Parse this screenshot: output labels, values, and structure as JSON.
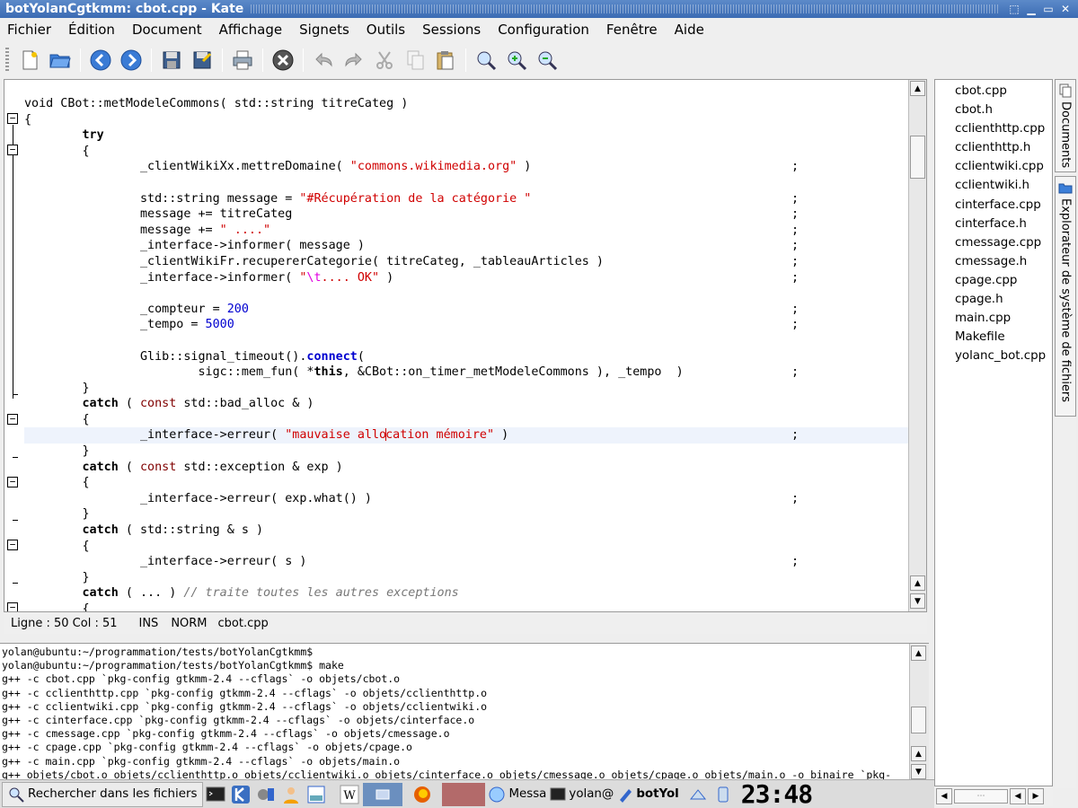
{
  "window": {
    "title": "botYolanCgtkmm: cbot.cpp - Kate",
    "buttons": [
      "⬚",
      "▁",
      "▭",
      "✕"
    ]
  },
  "menu": [
    "Fichier",
    "Édition",
    "Document",
    "Affichage",
    "Signets",
    "Outils",
    "Sessions",
    "Configuration",
    "Fenêtre",
    "Aide"
  ],
  "toolbar_icons": [
    "new-document-icon",
    "open-folder-icon",
    "back-icon",
    "forward-icon",
    "save-icon",
    "save-as-icon",
    "print-icon",
    "close-document-icon",
    "undo-icon",
    "redo-icon",
    "cut-icon",
    "copy-icon",
    "paste-icon",
    "find-icon",
    "zoom-in-icon",
    "zoom-out-icon"
  ],
  "code": [
    {
      "t": "void CBot::metModeleCommons( std::string titreCateg )"
    },
    {
      "t": "{"
    },
    {
      "t": "        try"
    },
    {
      "t": "        {"
    },
    {
      "t": "                _clientWikiXx.mettreDomaine( \"commons.wikimedia.org\" )",
      "semi": true
    },
    {
      "t": ""
    },
    {
      "t": "                std::string message = \"#Récupération de la catégorie \"",
      "semi": true
    },
    {
      "t": "                message += titreCateg",
      "semi": true
    },
    {
      "t": "                message += \" ....\"",
      "semi": true
    },
    {
      "t": "                _interface->informer( message )",
      "semi": true
    },
    {
      "t": "                _clientWikiFr.recupererCategorie( titreCateg, _tableauArticles )",
      "semi": true
    },
    {
      "t": "                _interface->informer( \"\\t.... OK\" )",
      "semi": true
    },
    {
      "t": ""
    },
    {
      "t": "                _compteur = 200",
      "semi": true
    },
    {
      "t": "                _tempo = 5000",
      "semi": true
    },
    {
      "t": ""
    },
    {
      "t": "                Glib::signal_timeout().connect("
    },
    {
      "t": "                        sigc::mem_fun( *this, &CBot::on_timer_metModeleCommons ), _tempo  )",
      "semi": true
    },
    {
      "t": "        }"
    },
    {
      "t": "        catch ( const std::bad_alloc & )"
    },
    {
      "t": "        {"
    },
    {
      "t": "                _interface->erreur( \"mauvaise allocation mémoire\" )",
      "semi": true,
      "current": true
    },
    {
      "t": "        }"
    },
    {
      "t": "        catch ( const std::exception & exp )"
    },
    {
      "t": "        {"
    },
    {
      "t": "                _interface->erreur( exp.what() )",
      "semi": true
    },
    {
      "t": "        }"
    },
    {
      "t": "        catch ( std::string & s )"
    },
    {
      "t": "        {"
    },
    {
      "t": "                _interface->erreur( s )",
      "semi": true
    },
    {
      "t": "        }"
    },
    {
      "t": "        catch ( ... ) // traite toutes les autres exceptions"
    },
    {
      "t": "        {"
    }
  ],
  "semicolon": ";",
  "status": {
    "position": "Ligne : 50 Col : 51",
    "mode1": "INS",
    "mode2": "NORM",
    "file": "cbot.cpp"
  },
  "terminal": [
    "yolan@ubuntu:~/programmation/tests/botYolanCgtkmm$",
    "yolan@ubuntu:~/programmation/tests/botYolanCgtkmm$ make",
    "g++ -c cbot.cpp `pkg-config gtkmm-2.4 --cflags` -o objets/cbot.o",
    "g++ -c cclienthttp.cpp `pkg-config gtkmm-2.4 --cflags` -o objets/cclienthttp.o",
    "g++ -c cclientwiki.cpp `pkg-config gtkmm-2.4 --cflags` -o objets/cclientwiki.o",
    "g++ -c cinterface.cpp `pkg-config gtkmm-2.4 --cflags` -o objets/cinterface.o",
    "g++ -c cmessage.cpp `pkg-config gtkmm-2.4 --cflags` -o objets/cmessage.o",
    "g++ -c cpage.cpp `pkg-config gtkmm-2.4 --cflags` -o objets/cpage.o",
    "g++ -c main.cpp `pkg-config gtkmm-2.4 --cflags` -o objets/main.o",
    "g++ objets/cbot.o objets/cclienthttp.o objets/cclientwiki.o objets/cinterface.o objets/cmessage.o objets/cpage.o objets/main.o -o binaire `pkg-"
  ],
  "files": [
    "cbot.cpp",
    "cbot.h",
    "cclienthttp.cpp",
    "cclienthttp.h",
    "cclientwiki.cpp",
    "cclientwiki.h",
    "cinterface.cpp",
    "cinterface.h",
    "cmessage.cpp",
    "cmessage.h",
    "cpage.cpp",
    "cpage.h",
    "main.cpp",
    "Makefile",
    "yolanc_bot.cpp"
  ],
  "side_tabs": {
    "documents": "Documents",
    "explorer": "Explorateur de système de fichiers"
  },
  "taskbar": {
    "search_label": "Rechercher dans les fichiers",
    "tasks": [
      "Messa",
      "yolan@",
      "botYol"
    ],
    "clock": "23:48"
  },
  "colors": {
    "titlebar": "#3b6bb3",
    "string": "#d00000",
    "number": "#0000d0",
    "current_line": "#eef3fc"
  }
}
